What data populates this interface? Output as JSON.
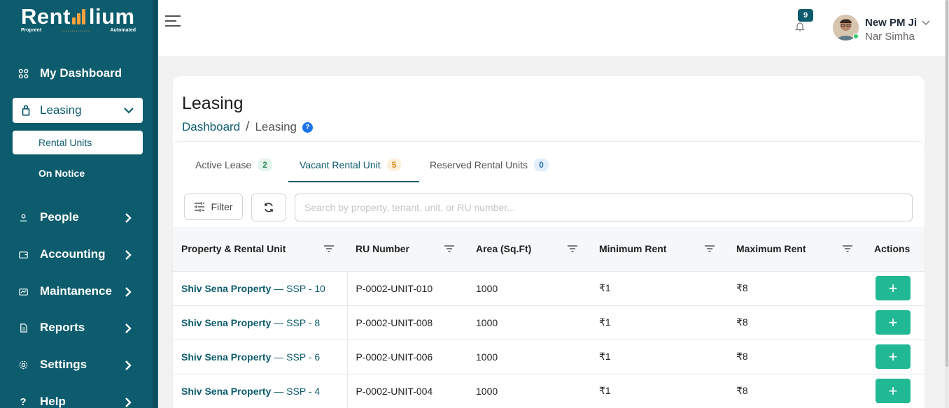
{
  "brand": {
    "name_prefix": "Rent",
    "name_suffix": "lium",
    "tagline_left": "Proprent",
    "tagline_dots": "..............",
    "tagline_right": "Automated",
    "accent_color": "#0d5c6e",
    "highlight_color": "#f6a23c"
  },
  "sidebar": {
    "dashboard_label": "My Dashboard",
    "leasing_label": "Leasing",
    "leasing_sub": {
      "active": "Rental Units",
      "other": "On Notice"
    },
    "items": [
      {
        "label": "People",
        "icon": "person-icon"
      },
      {
        "label": "Accounting",
        "icon": "wallet-icon"
      },
      {
        "label": "Maintanence",
        "icon": "tools-icon"
      },
      {
        "label": "Reports",
        "icon": "document-icon"
      },
      {
        "label": "Settings",
        "icon": "gear-icon"
      },
      {
        "label": "Help",
        "icon": "question-icon"
      }
    ]
  },
  "header": {
    "notification_count": "9",
    "user_name": "New PM Ji",
    "user_role": "Nar Simha"
  },
  "page": {
    "title": "Leasing",
    "breadcrumb_root": "Dashboard",
    "breadcrumb_sep": "/",
    "breadcrumb_current": "Leasing",
    "help": "?"
  },
  "tabs": [
    {
      "label": "Active Lease",
      "count": "2"
    },
    {
      "label": "Vacant Rental Unit",
      "count": "5"
    },
    {
      "label": "Reserved Rental Units",
      "count": "0"
    }
  ],
  "toolbar": {
    "filter_label": "Filter",
    "search_placeholder": "Search by property, tenant, unit, or RU number..."
  },
  "table": {
    "columns": [
      "Property & Rental Unit",
      "RU Number",
      "Area (Sq.Ft)",
      "Minimum Rent",
      "Maximum Rent",
      "Actions"
    ],
    "rows": [
      {
        "property": "Shiv Sena Property",
        "unit": " — SSP - 10",
        "ru": "P-0002-UNIT-010",
        "area": "1000",
        "min": "₹1",
        "max": "₹8",
        "action": "+"
      },
      {
        "property": "Shiv Sena Property",
        "unit": " — SSP - 8",
        "ru": "P-0002-UNIT-008",
        "area": "1000",
        "min": "₹1",
        "max": "₹8",
        "action": "+"
      },
      {
        "property": "Shiv Sena Property",
        "unit": " — SSP - 6",
        "ru": "P-0002-UNIT-006",
        "area": "1000",
        "min": "₹1",
        "max": "₹8",
        "action": "+"
      },
      {
        "property": "Shiv Sena Property",
        "unit": " — SSP - 4",
        "ru": "P-0002-UNIT-004",
        "area": "1000",
        "min": "₹1",
        "max": "₹8",
        "action": "+"
      }
    ]
  }
}
